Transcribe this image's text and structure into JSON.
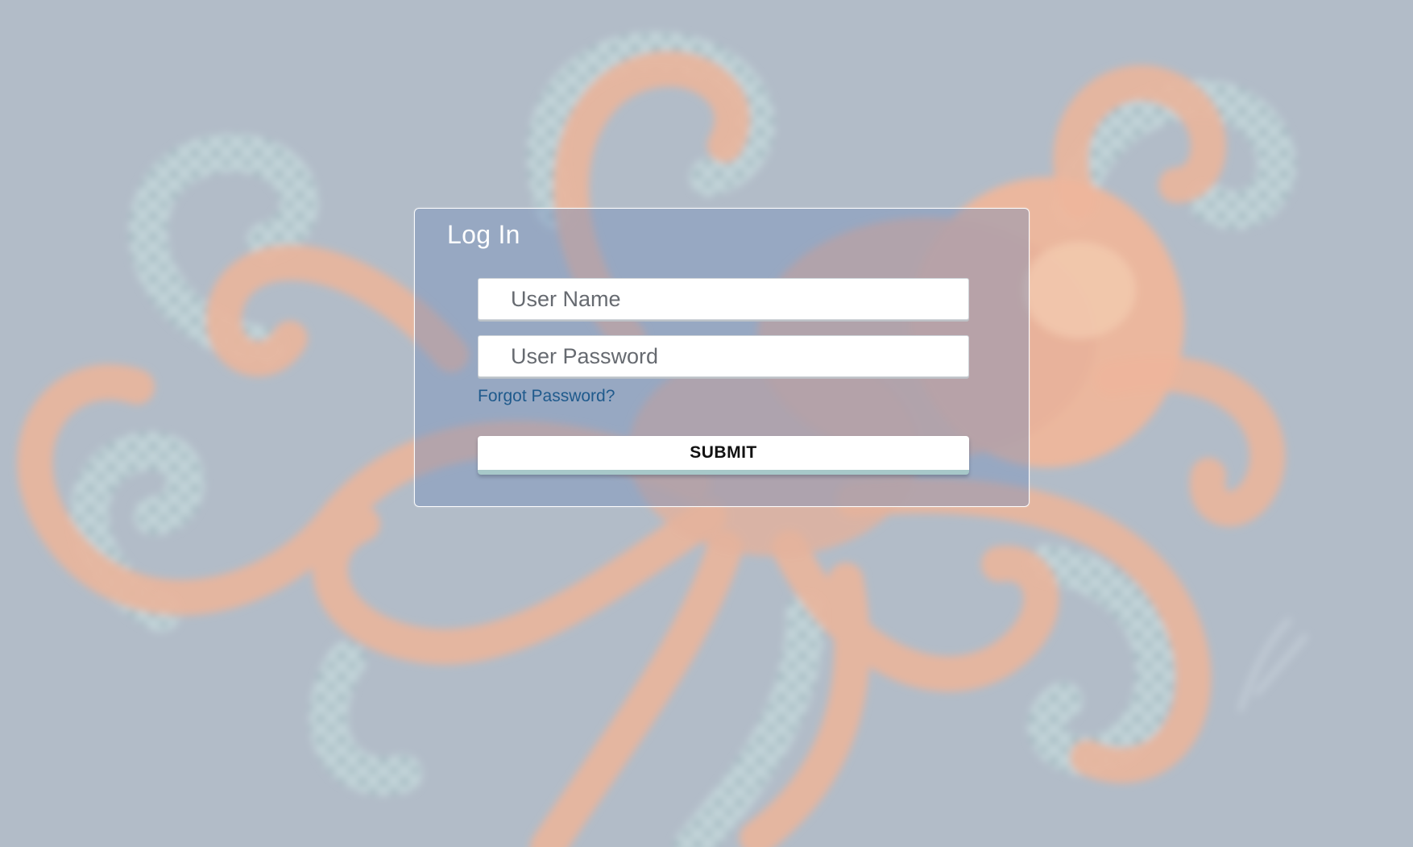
{
  "page": {
    "background_color": "#b2bcc8",
    "background_art": "blurred-octopus-illustration"
  },
  "login": {
    "title": "Log In",
    "username": {
      "placeholder": "User Name",
      "value": ""
    },
    "password": {
      "placeholder": "User Password",
      "value": ""
    },
    "forgot_label": "Forgot Password?",
    "submit_label": "SUBMIT",
    "colors": {
      "link": "#1f5a8c",
      "submit_border": "#a7c8c9",
      "panel_tint": "#738cb9"
    }
  }
}
